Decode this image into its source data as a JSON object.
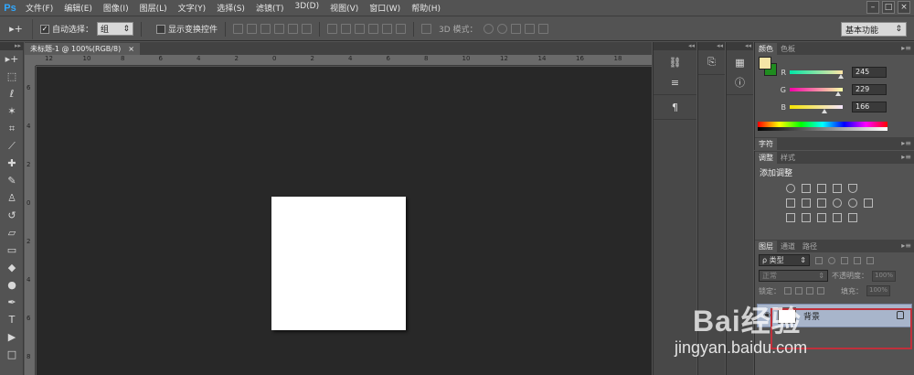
{
  "menubar": {
    "logo": "Ps",
    "items": [
      "文件(F)",
      "编辑(E)",
      "图像(I)",
      "图层(L)",
      "文字(Y)",
      "选择(S)",
      "滤镜(T)",
      "3D(D)",
      "视图(V)",
      "窗口(W)",
      "帮助(H)"
    ],
    "win_minimize": "–",
    "win_restore": "□",
    "win_close": "×"
  },
  "options": {
    "tool_glyph": "▸+",
    "auto_select_label": "自动选择：",
    "auto_select_value": "组",
    "show_transform_label": "显示变换控件",
    "mode3d_label": "3D 模式：",
    "workspace": "基本功能"
  },
  "document": {
    "tab_label": "未标题-1 @ 100%(RGB/8)",
    "tab_close": "×",
    "ruler_top": [
      "12",
      "10",
      "8",
      "6",
      "4",
      "2",
      "0",
      "2",
      "4",
      "6",
      "8",
      "10",
      "12",
      "14",
      "16",
      "18"
    ],
    "ruler_left": [
      "6",
      "4",
      "2",
      "0",
      "2",
      "4",
      "6",
      "8"
    ]
  },
  "toolbar": {
    "tools": [
      "move-tool",
      "marquee-tool",
      "lasso-tool",
      "magic-wand-tool",
      "crop-tool",
      "eyedropper-tool",
      "healing-tool",
      "brush-tool",
      "clone-stamp-tool",
      "history-brush-tool",
      "eraser-tool",
      "gradient-tool",
      "blur-tool",
      "dodge-tool",
      "pen-tool",
      "type-tool",
      "path-select-tool",
      "shape-tool"
    ]
  },
  "color_panel": {
    "tab_color": "颜色",
    "tab_swatches": "色板",
    "r_label": "R",
    "g_label": "G",
    "b_label": "B",
    "r_value": "245",
    "g_value": "229",
    "b_value": "166",
    "fg_color": "#f5e5a6",
    "bg_color": "#1f8c1f"
  },
  "char_panel": {
    "tab": "字符"
  },
  "adjust_panel": {
    "tab_adjust": "调整",
    "tab_styles": "样式",
    "title": "添加调整"
  },
  "layers_panel": {
    "tab_layers": "图层",
    "tab_channels": "通道",
    "tab_paths": "路径",
    "filter_label": "ρ 类型",
    "blend_mode": "正常",
    "opacity_label": "不透明度：",
    "opacity_value": "100%",
    "lock_label": "锁定：",
    "fill_label": "填充：",
    "fill_value": "100%",
    "bg_layer_name": "背景"
  },
  "watermark": {
    "text": "Bai经验",
    "sub": "jingyan.baidu.com"
  }
}
